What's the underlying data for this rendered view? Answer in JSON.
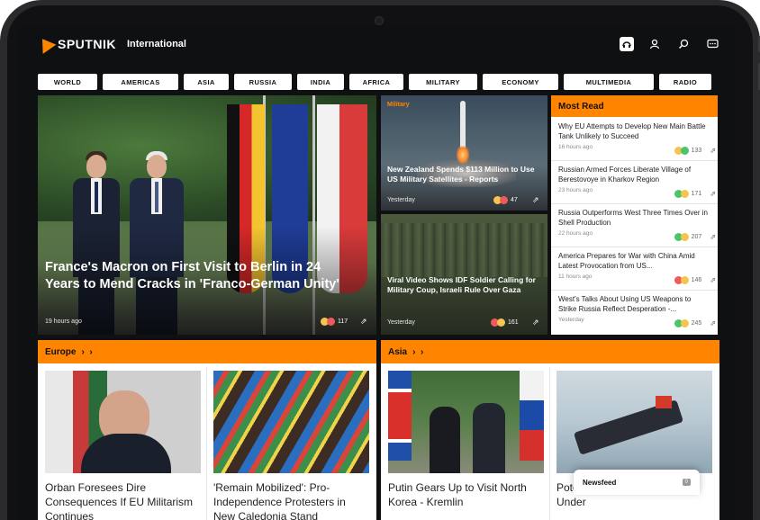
{
  "header": {
    "brand": "SPUTNIK",
    "edition": "International",
    "icons": [
      "radio-icon",
      "user-icon",
      "search-icon",
      "chat-icon"
    ]
  },
  "nav": {
    "items": [
      "WORLD",
      "AMERICAS",
      "ASIA",
      "RUSSIA",
      "INDIA",
      "AFRICA",
      "MILITARY",
      "ECONOMY",
      "MULTIMEDIA",
      "RADIO"
    ]
  },
  "hero": {
    "title": "France's Macron on First Visit to Berlin in 24 Years to Mend Cracks in 'Franco-German Unity'",
    "time": "19 hours ago",
    "reactions": "117"
  },
  "mid": {
    "card1": {
      "category": "Military",
      "title": "New Zealand Spends $113 Million to Use US Military Satellites - Reports",
      "time": "Yesterday",
      "reactions": "47"
    },
    "card2": {
      "title": "Viral Video Shows IDF Soldier Calling for Military Coup, Israeli Rule Over Gaza",
      "time": "Yesterday",
      "reactions": "161"
    }
  },
  "most_read": {
    "title": "Most Read",
    "items": [
      {
        "title": "Why EU Attempts to Develop New Main Battle Tank Unlikely to Succeed",
        "time": "16 hours ago",
        "reactions": "133"
      },
      {
        "title": "Russian Armed Forces Liberate Village of Berestovoye in Kharkov Region",
        "time": "23 hours ago",
        "reactions": "171"
      },
      {
        "title": "Russia Outperforms West Three Times Over in Shell Production",
        "time": "22 hours ago",
        "reactions": "207"
      },
      {
        "title": "America Prepares for War with China Amid Latest Provocation from US...",
        "time": "11 hours ago",
        "reactions": "146"
      },
      {
        "title": "West's Talks About Using US Weapons to Strike Russia Reflect Desperation -...",
        "time": "Yesterday",
        "reactions": "245"
      }
    ]
  },
  "sections": {
    "europe": {
      "label": "Europe",
      "tiles": [
        "Orban Foresees Dire Consequences If EU Militarism Continues",
        "'Remain Mobilized': Pro-Independence Protesters in New Caledonia Stand"
      ]
    },
    "asia": {
      "label": "Asia",
      "tiles": [
        "Putin Gears Up to Visit North Korea - Kremlin",
        "Potential Northern Sea Route Under"
      ]
    }
  },
  "newsfeed": {
    "label": "Newsfeed",
    "badge": "0"
  },
  "colors": {
    "accent": "#ff8400",
    "background": "#0f1012"
  }
}
